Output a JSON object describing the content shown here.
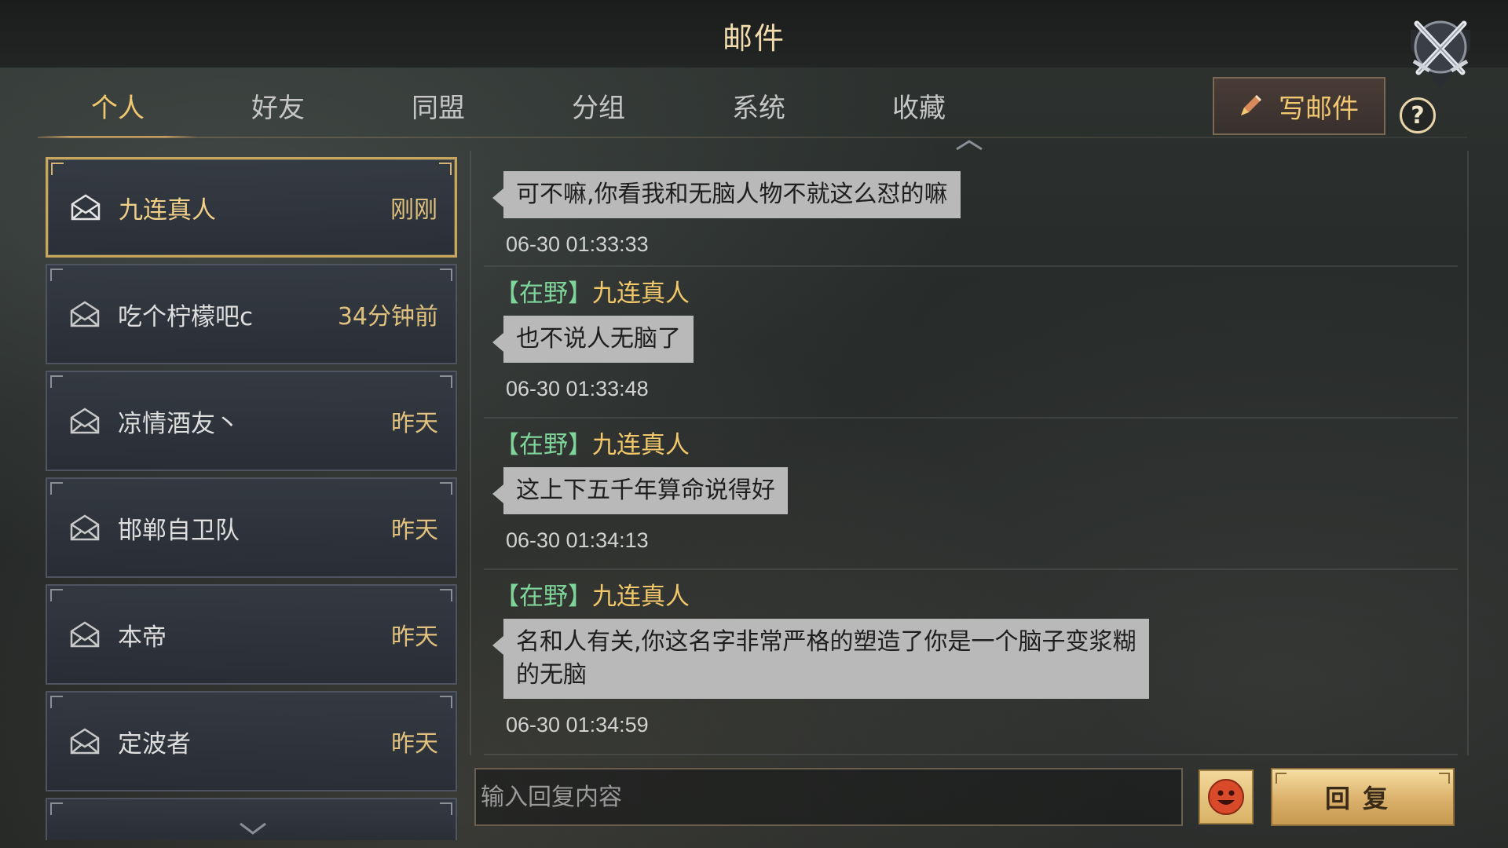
{
  "window": {
    "title": "邮件"
  },
  "tabs": [
    {
      "label": "个人",
      "active": true
    },
    {
      "label": "好友",
      "active": false
    },
    {
      "label": "同盟",
      "active": false
    },
    {
      "label": "分组",
      "active": false
    },
    {
      "label": "系统",
      "active": false
    },
    {
      "label": "收藏",
      "active": false
    }
  ],
  "toolbar": {
    "compose_label": "写邮件",
    "help_label": "?"
  },
  "mail_list": [
    {
      "name": "九连真人",
      "time": "刚刚",
      "selected": true
    },
    {
      "name": "吃个柠檬吧c",
      "time": "34分钟前",
      "selected": false
    },
    {
      "name": "凉情酒友丶",
      "time": "昨天",
      "selected": false
    },
    {
      "name": "邯郸自卫队",
      "time": "昨天",
      "selected": false
    },
    {
      "name": "本帝",
      "time": "昨天",
      "selected": false
    },
    {
      "name": "定波者",
      "time": "昨天",
      "selected": false
    }
  ],
  "messages": [
    {
      "faction": "",
      "sender": "",
      "text": "可不嘛,你看我和无脑人物不就这么怼的嘛",
      "timestamp": "06-30 01:33:33"
    },
    {
      "faction": "【在野】",
      "sender": "九连真人",
      "text": "也不说人无脑了",
      "timestamp": "06-30 01:33:48"
    },
    {
      "faction": "【在野】",
      "sender": "九连真人",
      "text": "这上下五千年算命说得好",
      "timestamp": "06-30 01:34:13"
    },
    {
      "faction": "【在野】",
      "sender": "九连真人",
      "text_line1": "名和人有关,你这名字非常严格的塑造了你是一个脑子变浆糊",
      "text_line2": "的无脑",
      "timestamp": "06-30 01:34:59"
    }
  ],
  "reply": {
    "placeholder": "输入回复内容",
    "value": "",
    "send_label": "回复"
  },
  "icons": {
    "close": "crossed-swords-icon",
    "compose": "pencil-icon",
    "mail": "envelope-icon",
    "emoji": "smiley-icon"
  },
  "colors": {
    "accent_gold": "#f1c870",
    "faction_green": "#7fd49a",
    "bubble_gray": "#b9b9b9",
    "reply_button": "#dab06a"
  }
}
